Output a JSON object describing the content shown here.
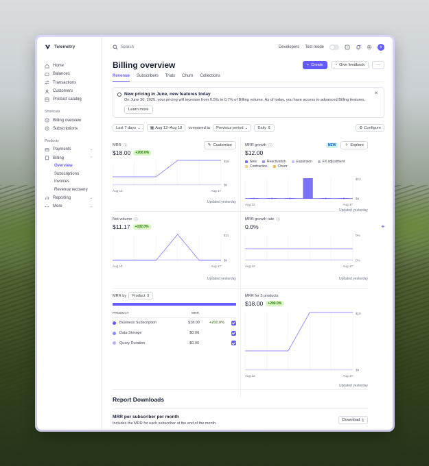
{
  "app": {
    "name": "Telemetry"
  },
  "sidebar": {
    "items": [
      {
        "label": "Home",
        "icon": "home-icon"
      },
      {
        "label": "Balances",
        "icon": "balances-icon"
      },
      {
        "label": "Transactions",
        "icon": "transactions-icon"
      },
      {
        "label": "Customers",
        "icon": "customers-icon"
      },
      {
        "label": "Product catalog",
        "icon": "catalog-icon"
      }
    ],
    "shortcuts_label": "Shortcuts",
    "shortcuts": [
      {
        "label": "Billing overview",
        "icon": "clock-icon"
      },
      {
        "label": "Subscriptions",
        "icon": "clock-icon"
      }
    ],
    "products_label": "Products",
    "products": {
      "payments": "Payments",
      "billing": "Billing",
      "billing_sub": [
        "Overview",
        "Subscriptions",
        "Invoices",
        "Revenue recovery"
      ],
      "reporting": "Reporting",
      "more": "More"
    }
  },
  "topbar": {
    "search_placeholder": "Search",
    "developers": "Developers",
    "test_mode": "Test mode"
  },
  "page": {
    "title": "Billing overview",
    "create": "Create",
    "feedback": "Give feedback",
    "more": "···",
    "tabs": [
      "Revenue",
      "Subscribers",
      "Trials",
      "Churn",
      "Collections"
    ]
  },
  "notice": {
    "title": "New pricing in June, new features today",
    "body": "On June 30, 2025, your pricing will increase from 0.5% to 0.7% of Billing volume. As of today, you have access to advanced Billing features.",
    "learn_more": "Learn more"
  },
  "filters": {
    "range": "Last 7 days",
    "dates": "Aug 12–Aug 18",
    "compared_to": "compared to",
    "previous": "Previous period",
    "granularity": "Daily",
    "configure": "Configure"
  },
  "panels": {
    "mrr": {
      "title": "MRR",
      "value": "$18.00",
      "change": "+200.0%",
      "customize": "Customize",
      "updated": "Updated yesterday"
    },
    "mrr_growth": {
      "title": "MRR growth",
      "value": "$12.00",
      "new_badge": "NEW",
      "explore": "Explore",
      "updated": "Updated yesterday",
      "legend": [
        {
          "name": "New",
          "color": "#7b73f7"
        },
        {
          "name": "Reactivation",
          "color": "#9a94f7"
        },
        {
          "name": "Expansion",
          "color": "#c4c0fb"
        },
        {
          "name": "FX adjustment",
          "color": "#b8bcc6"
        },
        {
          "name": "Contraction",
          "color": "#f6d58a"
        },
        {
          "name": "Churn",
          "color": "#f3b94f"
        }
      ]
    },
    "net_volume": {
      "title": "Net volume",
      "value": "$11.17",
      "change": "+102.0%",
      "updated": "Updated yesterday"
    },
    "mrr_growth_rate": {
      "title": "MRR growth rate",
      "value": "0.0%",
      "updated": "Updated yesterday"
    },
    "mrr_by": {
      "title": "MRR by",
      "select": "Product",
      "col_product": "PRODUCT",
      "col_mrr": "MRR",
      "rows": [
        {
          "name": "Business Subscription",
          "mrr": "$18.00",
          "change": "+200.0%",
          "color": "#635bff"
        },
        {
          "name": "Data Storage",
          "mrr": "$0.00",
          "change": "",
          "color": "#8f88ff"
        },
        {
          "name": "Query Duration",
          "mrr": "$0.00",
          "change": "",
          "color": "#b7b2ff"
        }
      ]
    },
    "mrr_products": {
      "title": "MRR for 3 products",
      "value": "$18.00",
      "change": "+200.0%",
      "updated": "Updated yesterday"
    }
  },
  "reports": {
    "title": "Report Downloads",
    "item_title": "MRR per subscriber per month",
    "item_desc": "Includes the MRR for each subscriber at the end of the month.",
    "download": "Download"
  },
  "chart_data": [
    {
      "type": "line",
      "title": "MRR",
      "x": [
        "Aug 12",
        "Aug 13",
        "Aug 14",
        "Aug 15",
        "Aug 16",
        "Aug 17"
      ],
      "series": [
        {
          "values": [
            6,
            6,
            6,
            18,
            18,
            18
          ]
        }
      ],
      "ylim": [
        0,
        18
      ],
      "yticks": [
        "$0",
        "$18"
      ],
      "xticks": [
        "Aug 12",
        "Aug 17"
      ]
    },
    {
      "type": "bar",
      "title": "MRR growth",
      "x": [
        "Aug 12",
        "Aug 13",
        "Aug 14",
        "Aug 15",
        "Aug 16",
        "Aug 17"
      ],
      "series": [
        {
          "name": "New",
          "values": [
            0,
            0,
            0,
            12,
            0,
            0
          ]
        }
      ],
      "ylim": [
        0,
        12
      ],
      "yticks": [
        "$0",
        "$12"
      ],
      "xticks": [
        "Aug 12",
        "Aug 17"
      ]
    },
    {
      "type": "line",
      "title": "Net volume",
      "x": [
        "Aug 12",
        "Aug 13",
        "Aug 14",
        "Aug 15",
        "Aug 16",
        "Aug 17"
      ],
      "series": [
        {
          "values": [
            0,
            0,
            0,
            11,
            0,
            0
          ]
        }
      ],
      "ylim": [
        0,
        11
      ],
      "yticks": [
        "$0",
        "$11"
      ],
      "xticks": [
        "Aug 12",
        "Aug 17"
      ]
    },
    {
      "type": "line",
      "title": "MRR growth rate",
      "x": [
        "Aug 12",
        "Aug 13",
        "Aug 14",
        "Aug 15",
        "Aug 16",
        "Aug 17"
      ],
      "series": [
        {
          "values": [
            0,
            0,
            0,
            0,
            0,
            0
          ]
        }
      ],
      "ylim": [
        0,
        0
      ],
      "yticks": [
        "0%",
        "0%"
      ],
      "xticks": [
        "Aug 12",
        "Aug 17"
      ]
    },
    {
      "type": "line",
      "title": "MRR for 3 products",
      "x": [
        "Aug 12",
        "Aug 13",
        "Aug 14",
        "Aug 15",
        "Aug 16",
        "Aug 17"
      ],
      "series": [
        {
          "values": [
            6,
            6,
            6,
            18,
            18,
            18
          ]
        }
      ],
      "ylim": [
        0,
        18
      ],
      "yticks": [
        "$0",
        "$18"
      ],
      "xticks": [
        "Aug 12",
        "Aug 17"
      ]
    }
  ]
}
